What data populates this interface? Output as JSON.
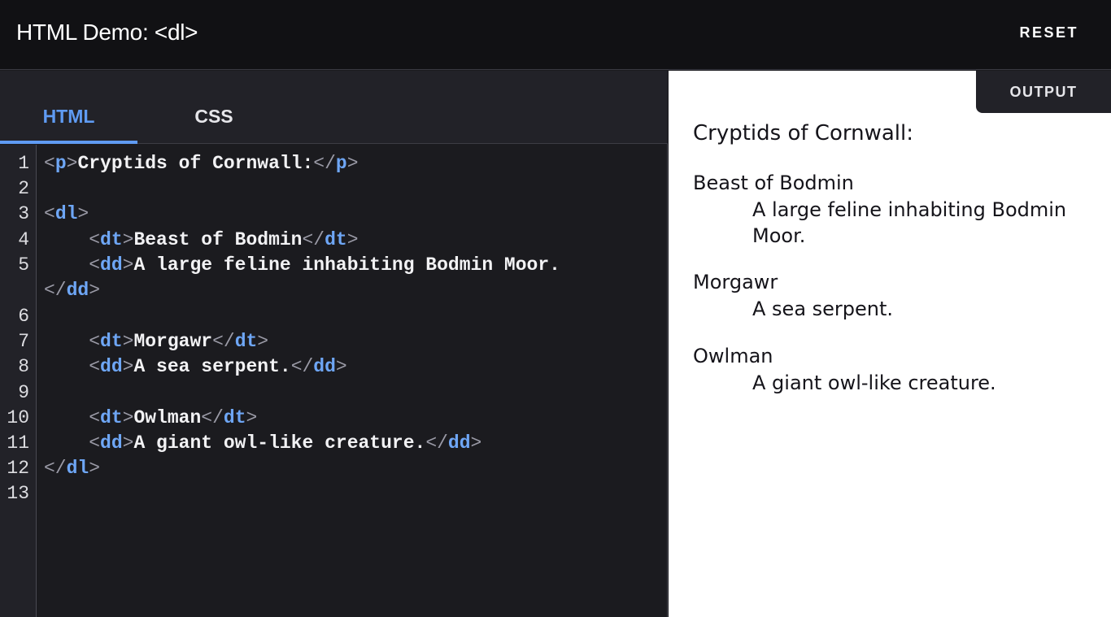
{
  "header": {
    "title": "HTML Demo: <dl>",
    "reset_label": "RESET"
  },
  "editor": {
    "tabs": [
      {
        "label": "HTML",
        "active": true
      },
      {
        "label": "CSS",
        "active": false
      }
    ],
    "line_numbers": [
      "1",
      "2",
      "3",
      "4",
      "5",
      "6",
      "7",
      "8",
      "9",
      "10",
      "11",
      "12",
      "13"
    ],
    "code": {
      "l1_open": "p",
      "l1_text": "Cryptids of Cornwall:",
      "l1_close": "p",
      "l3_open": "dl",
      "l4_open": "dt",
      "l4_text": "Beast of Bodmin",
      "l4_close": "dt",
      "l5_open": "dd",
      "l5_text": "A large feline inhabiting Bodmin Moor.",
      "l5_close": "dd",
      "l7_open": "dt",
      "l7_text": "Morgawr",
      "l7_close": "dt",
      "l8_open": "dd",
      "l8_text": "A sea serpent.",
      "l8_close": "dd",
      "l10_open": "dt",
      "l10_text": "Owlman",
      "l10_close": "dt",
      "l11_open": "dd",
      "l11_text": "A giant owl-like creature.",
      "l11_close": "dd",
      "l12_close": "dl"
    }
  },
  "output": {
    "tab_label": "OUTPUT",
    "paragraph": "Cryptids of Cornwall:",
    "entries": [
      {
        "term": "Beast of Bodmin",
        "desc": "A large feline inhabiting Bodmin Moor."
      },
      {
        "term": "Morgawr",
        "desc": "A sea serpent."
      },
      {
        "term": "Owlman",
        "desc": "A giant owl-like creature."
      }
    ]
  },
  "colors": {
    "tag": "#6ea6f5",
    "bracket": "#9a9aa6",
    "active_tab": "#5f9bf3"
  }
}
